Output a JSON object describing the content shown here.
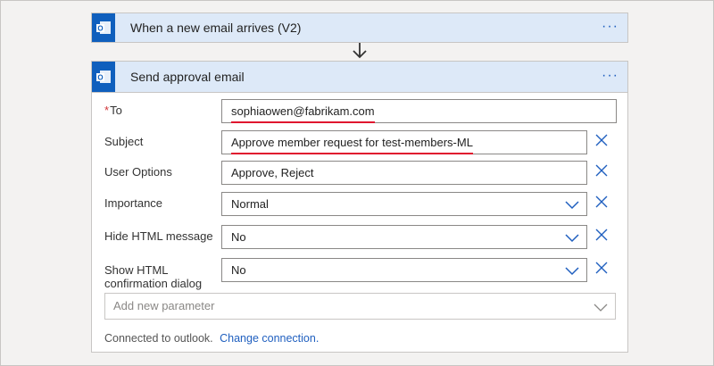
{
  "trigger": {
    "title": "When a new email arrives (V2)",
    "more": "···",
    "icon": "outlook-icon"
  },
  "action": {
    "title": "Send approval email",
    "more": "···",
    "icon": "outlook-icon",
    "fields": {
      "to": {
        "label": "To",
        "required_mark": "*",
        "value": "sophiaowen@fabrikam.com"
      },
      "subject": {
        "label": "Subject",
        "value": "Approve member request for test-members-ML"
      },
      "user_options": {
        "label": "User Options",
        "value": "Approve, Reject"
      },
      "importance": {
        "label": "Importance",
        "value": "Normal"
      },
      "hide_html": {
        "label": "Hide HTML message",
        "value": "No"
      },
      "show_confirmation": {
        "label_line1": "Show HTML",
        "label_line2": "confirmation dialog",
        "value": "No"
      }
    },
    "add_parameter": {
      "placeholder": "Add new parameter"
    },
    "footer": {
      "connected_text": "Connected to outlook.",
      "change_link": "Change connection."
    }
  },
  "colors": {
    "header_bg": "#dde9f8",
    "icon_bg": "#0f5fbd",
    "accent": "#1f5fbf",
    "required": "#d13438",
    "highlight_underline": "#e0152e"
  }
}
